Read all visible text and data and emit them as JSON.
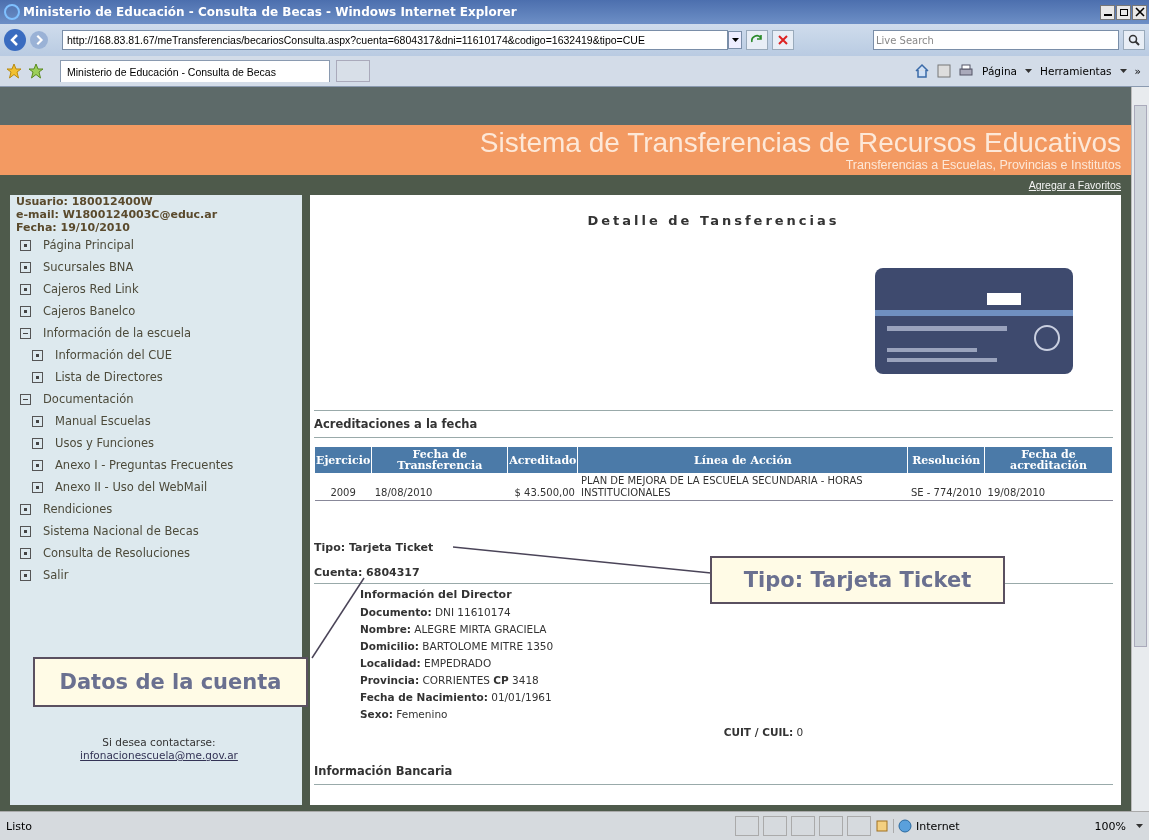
{
  "window": {
    "title": "Ministerio de Educación - Consulta de Becas - Windows Internet Explorer"
  },
  "address_bar": {
    "url": "http://168.83.81.67/meTransferencias/becariosConsulta.aspx?cuenta=6804317&dni=11610174&codigo=1632419&tipo=CUE",
    "search_placeholder": "Live Search"
  },
  "tab": {
    "title": "Ministerio de Educación - Consulta de Becas"
  },
  "command_bar": {
    "items": [
      "Página",
      "Herramientas"
    ],
    "overflow": "»"
  },
  "banner": {
    "title": "Sistema de Transferencias de Recursos Educativos",
    "subtitle": "Transferencias a Escuelas, Provincias e Institutos",
    "favorites_link": "Agregar a Favoritos"
  },
  "user_info": [
    "Usuario: 180012400W",
    "e-mail: W1800124003C@educ.ar",
    "Fecha: 19/10/2010"
  ],
  "sidebar": {
    "items": [
      {
        "label": "Página Principal",
        "expanded": false
      },
      {
        "label": "Sucursales BNA",
        "expanded": false
      },
      {
        "label": "Cajeros Red Link",
        "expanded": false
      },
      {
        "label": "Cajeros Banelco",
        "expanded": false
      },
      {
        "label": "Información de la escuela",
        "expanded": true,
        "children": [
          {
            "label": "Información del CUE",
            "expanded": false
          },
          {
            "label": "Lista de Directores",
            "expanded": false
          }
        ]
      },
      {
        "label": "Documentación",
        "expanded": true,
        "children": [
          {
            "label": "Manual Escuelas",
            "expanded": false
          },
          {
            "label": "Usos y Funciones",
            "expanded": false
          },
          {
            "label": "Anexo I - Preguntas Frecuentes",
            "expanded": false
          },
          {
            "label": "Anexo II - Uso del WebMail",
            "expanded": false
          }
        ]
      },
      {
        "label": "Rendiciones",
        "expanded": false
      },
      {
        "label": "Sistema Nacional de Becas",
        "expanded": false
      },
      {
        "label": "Consulta de Resoluciones",
        "expanded": false
      },
      {
        "label": "Salir",
        "expanded": false
      }
    ],
    "contact_text": "Si desea contactarse:",
    "contact_email": "infonacionescuela@me.gov.ar"
  },
  "content": {
    "title": "Detalle de Tansferencias",
    "section_title": "Acreditaciones a la fecha",
    "table": {
      "columns": [
        "Ejercicio",
        "Fecha de Transferencia",
        "Acreditado",
        "Línea de Acción",
        "Resolución",
        "Fecha de acreditación"
      ],
      "rows": [
        [
          "2009",
          "18/08/2010",
          "$ 43.500,00",
          "PLAN DE MEJORA DE LA ESCUELA SECUNDARIA - HORAS INSTITUCIONALES",
          "SE - 774/2010",
          "19/08/2010"
        ]
      ]
    },
    "tipo": "Tipo: Tarjeta Ticket",
    "cuenta": "Cuenta: 6804317",
    "director_title": "Información del Director",
    "director_fields": [
      "**Documento:** DNI 11610174",
      "**Nombre:** ALEGRE MIRTA GRACIELA",
      "**Domicilio:** BARTOLOME MITRE 1350",
      "**Localidad:** EMPEDRADO",
      "**Provincia:** CORRIENTES  **CP** 3418",
      "**Fecha de Nacimiento:** 01/01/1961",
      "**Sexo:** Femenino"
    ],
    "cuit": "**CUIT / CUIL:** 0",
    "bank_title": "Información Bancaria"
  },
  "callouts": [
    {
      "text": "Tipo: Tarjeta Ticket"
    },
    {
      "text": "Datos de la cuenta"
    }
  ],
  "status_bar": {
    "text": "Listo",
    "zone": "Internet",
    "zoom": "100%"
  }
}
